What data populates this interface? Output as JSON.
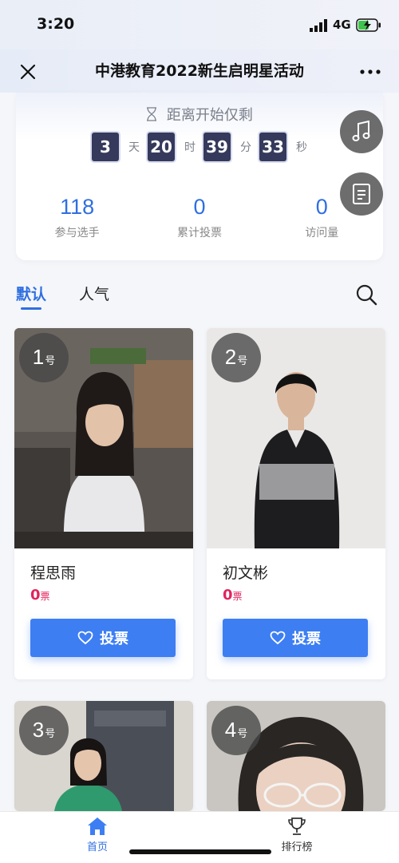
{
  "status_bar": {
    "time": "3:20",
    "network": "4G"
  },
  "nav": {
    "title": "中港教育2022新生启明星活动",
    "close_icon": "close-icon",
    "more_icon": "more-dots-icon"
  },
  "countdown": {
    "title": "距离开始仅剩",
    "days": "3",
    "days_unit": "天",
    "hours": "20",
    "hours_unit": "时",
    "minutes": "39",
    "minutes_unit": "分",
    "seconds": "33",
    "seconds_unit": "秒"
  },
  "stats": [
    {
      "value": "118",
      "label": "参与选手"
    },
    {
      "value": "0",
      "label": "累计投票"
    },
    {
      "value": "0",
      "label": "访问量"
    }
  ],
  "floating": {
    "music_icon": "music-note-icon",
    "notes_icon": "document-icon"
  },
  "tabs": {
    "default_label": "默认",
    "popular_label": "人气"
  },
  "candidates": [
    {
      "number": "1",
      "number_unit": "号",
      "name": "程思雨",
      "votes": "0",
      "votes_unit": "票",
      "vote_label": "投票"
    },
    {
      "number": "2",
      "number_unit": "号",
      "name": "初文彬",
      "votes": "0",
      "votes_unit": "票",
      "vote_label": "投票"
    },
    {
      "number": "3",
      "number_unit": "号"
    },
    {
      "number": "4",
      "number_unit": "号"
    }
  ],
  "bottom_tabs": {
    "home": "首页",
    "ranking": "排行榜"
  },
  "colors": {
    "accent": "#2f6fe0",
    "vote_button": "#3d7ef3",
    "votes_red": "#e0245e",
    "countdown_box": "#353a5c"
  }
}
